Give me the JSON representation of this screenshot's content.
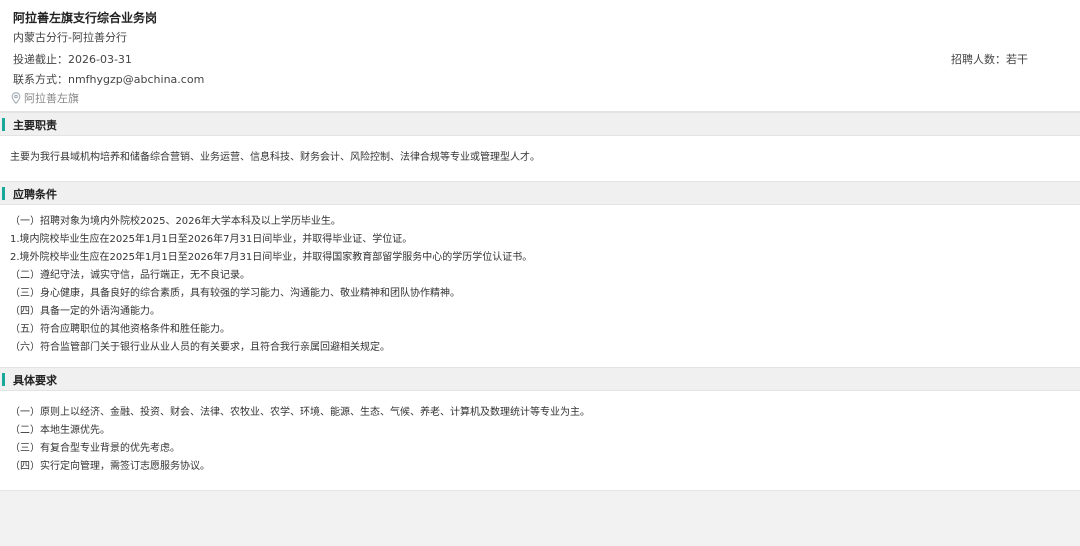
{
  "job": {
    "title": "阿拉善左旗支行综合业务岗",
    "branch": "内蒙古分行-阿拉善分行",
    "deadline_label": "投递截止：2026-03-31",
    "quota_label": "招聘人数：若干",
    "contact_label": "联系方式：nmfhygzp@abchina.com",
    "location": "阿拉善左旗",
    "location_icon": "map-pin-icon"
  },
  "sections": [
    {
      "title": "主要职责",
      "lines": [
        "主要为我行县域机构培养和储备综合营销、业务运营、信息科技、财务会计、风险控制、法律合规等专业或管理型人才。"
      ]
    },
    {
      "title": "应聘条件",
      "lines": [
        "（一）招聘对象为境内外院校2025、2026年大学本科及以上学历毕业生。",
        "1.境内院校毕业生应在2025年1月1日至2026年7月31日间毕业，并取得毕业证、学位证。",
        "2.境外院校毕业生应在2025年1月1日至2026年7月31日间毕业，并取得国家教育部留学服务中心的学历学位认证书。",
        "（二）遵纪守法，诚实守信，品行端正，无不良记录。",
        "（三）身心健康，具备良好的综合素质，具有较强的学习能力、沟通能力、敬业精神和团队协作精神。",
        "（四）具备一定的外语沟通能力。",
        "（五）符合应聘职位的其他资格条件和胜任能力。",
        "（六）符合监管部门关于银行业从业人员的有关要求，且符合我行亲属回避相关规定。"
      ]
    },
    {
      "title": "具体要求",
      "lines": [
        "（一）原则上以经济、金融、投资、财会、法律、农牧业、农学、环境、能源、生态、气候、养老、计算机及数理统计等专业为主。",
        "（二）本地生源优先。",
        "（三）有复合型专业背景的优先考虑。",
        "（四）实行定向管理，需签订志愿服务协议。"
      ]
    }
  ],
  "colors": {
    "accent": "#1aa89a",
    "section_bg": "#f0f0f0",
    "page_bg": "#f2f2f2"
  }
}
